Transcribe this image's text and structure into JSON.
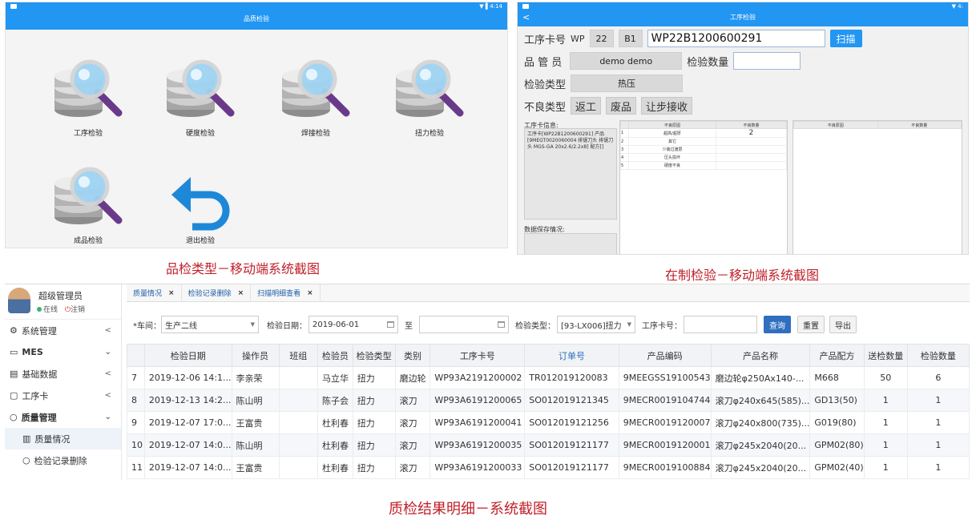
{
  "panel1": {
    "title": "品质检验",
    "status_right": "▼ ▌4:14",
    "tiles": [
      {
        "label": "工序检验",
        "icon": "database-search-icon"
      },
      {
        "label": "硬度检验",
        "icon": "database-search-icon"
      },
      {
        "label": "焊接检验",
        "icon": "database-search-icon"
      },
      {
        "label": "扭力检验",
        "icon": "database-search-icon"
      },
      {
        "label": "成品检验",
        "icon": "database-search-icon"
      },
      {
        "label": "退出检验",
        "icon": "undo-arrow-icon"
      }
    ],
    "caption": "品检类型－移动端系统截图"
  },
  "panel2": {
    "title": "工序检验",
    "back": "<",
    "status_right": "▼ 4:",
    "card_label": "工序卡号",
    "wp": "WP",
    "f1": "22",
    "f2": "B1",
    "card_no": "WP22B1200600291",
    "scan": "扫描",
    "qc_label": "品 管 员",
    "qc_value": "demo demo",
    "qty_label": "检验数量",
    "type_label": "检验类型",
    "type_value": "热压",
    "defect_label": "不良类型",
    "defect_buttons": [
      "返工",
      "废品",
      "让步接收"
    ],
    "info_label": "工序卡信息:",
    "info_text": "工序卡[WP22B1200600291] 产品[9MEGT0020060004 排锯刀头 排锯刀头 MGS-GA 20x2.6/2.2x8] 配方[]",
    "save_label": "数据保存情况:",
    "table1_headers": [
      "不良原因",
      "不良数量"
    ],
    "table1_rows": [
      {
        "no": "1",
        "reason": "超高/超厚",
        "qty": "2"
      },
      {
        "no": "2",
        "reason": "其它",
        "qty": ""
      },
      {
        "no": "3",
        "reason": "少装过渡层",
        "qty": ""
      },
      {
        "no": "4",
        "reason": "压头损坏",
        "qty": ""
      },
      {
        "no": "5",
        "reason": "硬度不良",
        "qty": ""
      }
    ],
    "table2_headers": [
      "不良原因",
      "不良数量"
    ],
    "caption": "在制检验－移动端系统截图"
  },
  "panel3": {
    "user_name": "超级管理员",
    "status_online": "在线",
    "logout": "注销",
    "menu": [
      {
        "label": "系统管理",
        "arrow": "<",
        "icon": "gear-icon"
      },
      {
        "label": "MES",
        "arrow": "⌄",
        "icon": "monitor-icon"
      },
      {
        "label": "基础数据",
        "arrow": "<",
        "icon": "data-icon"
      },
      {
        "label": "工序卡",
        "arrow": "<",
        "icon": "card-icon"
      },
      {
        "label": "质量管理",
        "arrow": "⌄",
        "icon": "circle-icon"
      },
      {
        "label": "质量情况",
        "arrow": "",
        "icon": "bar-chart-icon"
      },
      {
        "label": "检验记录删除",
        "arrow": "",
        "icon": "circle-icon"
      }
    ],
    "tabs": [
      {
        "label": "质量情况",
        "close": "×"
      },
      {
        "label": "检验记录删除",
        "close": "×"
      },
      {
        "label": "扫描明细查看",
        "close": "×"
      }
    ],
    "filter": {
      "workshop_label": "*车间：",
      "workshop_value": "生产二线",
      "date_label": "检验日期：",
      "date_from": "2019-06-01",
      "to_label": "至",
      "date_to": "",
      "type_label": "检验类型：",
      "type_value": "[93-LX006]扭力",
      "card_label": "工序卡号：",
      "card_value": "",
      "query": "查询",
      "reset": "重置",
      "export": "导出"
    },
    "columns": [
      "",
      "检验日期",
      "操作员",
      "班组",
      "检验员",
      "检验类型",
      "类别",
      "工序卡号",
      "订单号",
      "产品编码",
      "产品名称",
      "产品配方",
      "送检数量",
      "检验数量"
    ],
    "rows": [
      [
        "7",
        "2019-12-06 14:1...",
        "李亲荣",
        "",
        "马立华",
        "扭力",
        "磨边轮",
        "WP93A2191200002",
        "TR012019120083",
        "9MEEGSS19100543",
        "磨边轮φ250Ax140-...",
        "M668",
        "50",
        "6"
      ],
      [
        "8",
        "2019-12-13 14:2...",
        "陈山明",
        "",
        "陈子会",
        "扭力",
        "滚刀",
        "WP93A6191200065",
        "SO012019121345",
        "9MECR0019104744",
        "滚刀φ240x645(585)...",
        "GD13(50)",
        "1",
        "1"
      ],
      [
        "9",
        "2019-12-07 17:0...",
        "王富贵",
        "",
        "杜利春",
        "扭力",
        "滚刀",
        "WP93A6191200041",
        "SO012019121256",
        "9MECR0019120007",
        "滚刀φ240x800(735)...",
        "G019(80)",
        "1",
        "1"
      ],
      [
        "10",
        "2019-12-07 14:0...",
        "陈山明",
        "",
        "杜利春",
        "扭力",
        "滚刀",
        "WP93A6191200035",
        "SO012019121177",
        "9MECR0019120001",
        "滚刀φ245x2040(20...",
        "GPM02(80)",
        "1",
        "1"
      ],
      [
        "11",
        "2019-12-07 14:0...",
        "王富贵",
        "",
        "杜利春",
        "扭力",
        "滚刀",
        "WP93A6191200033",
        "SO012019121177",
        "9MECR0019100884",
        "滚刀φ245x2040(20...",
        "GPM02(40)",
        "1",
        "1"
      ]
    ],
    "caption": "质检结果明细－系统截图"
  }
}
